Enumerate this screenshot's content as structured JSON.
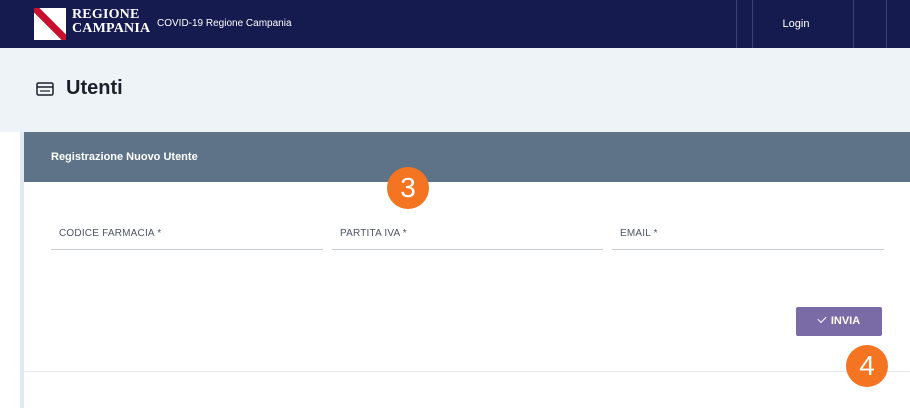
{
  "navbar": {
    "brand_line1": "REGIONE",
    "brand_line2": "CAMPANIA",
    "site_title": "COVID-19 Regione Campania",
    "login_label": "Login"
  },
  "page": {
    "title": "Utenti",
    "icon": "card-icon"
  },
  "form": {
    "header_title": "Registrazione Nuovo Utente",
    "fields": [
      {
        "label": "CODICE FARMACIA *",
        "value": ""
      },
      {
        "label": "PARTITA IVA *",
        "value": ""
      },
      {
        "label": "EMAIL *",
        "value": ""
      }
    ],
    "submit_label": "INVIA",
    "submit_icon": "check-icon"
  },
  "annotations": {
    "step_a": "3",
    "step_b": "4"
  },
  "colors": {
    "navbar": "#151a4f",
    "page_header": "#eef3f8",
    "card_header": "#5f7388",
    "button": "#7a6ba7",
    "badge": "#f47421",
    "logo_stripe": "#c8102e"
  }
}
